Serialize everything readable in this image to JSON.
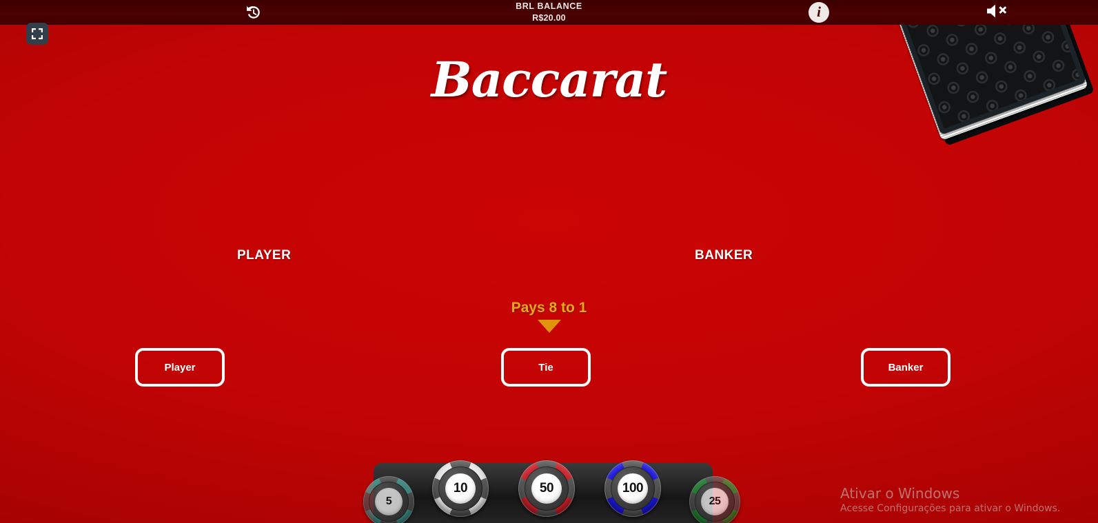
{
  "app": {
    "title": "Baccarat",
    "table_color": "#c20404",
    "accent_gold": "#e3a919"
  },
  "topbar": {
    "history_icon": "history-rewind-icon",
    "balance_label": "BRL BALANCE",
    "balance_value": "R$20.00",
    "info_icon": "info-icon",
    "info_glyph": "i"
  },
  "controls": {
    "fullscreen_icon": "fullscreen-expand-icon",
    "mute_icon": "speaker-muted-icon"
  },
  "table": {
    "deck_name": "card-deck",
    "spots": [
      {
        "key": "player",
        "header": "PLAYER",
        "button_label": "Player"
      },
      {
        "key": "tie",
        "header": "",
        "button_label": "Tie"
      },
      {
        "key": "banker",
        "header": "BANKER",
        "button_label": "Banker"
      }
    ],
    "player_header": "PLAYER",
    "banker_header": "BANKER",
    "player_label": "Player",
    "tie_label": "Tie",
    "banker_label": "Banker",
    "pays_note": "Pays 8 to 1"
  },
  "chips": {
    "selected": null,
    "items": [
      {
        "value": "5",
        "accent": "#3fa8a0",
        "partial": true,
        "side": "left"
      },
      {
        "value": "10",
        "accent": "#e9e9e9",
        "partial": false,
        "side": "center"
      },
      {
        "value": "50",
        "accent": "#cc1f28",
        "partial": false,
        "side": "center"
      },
      {
        "value": "100",
        "accent": "#1a16e0",
        "partial": false,
        "side": "center"
      },
      {
        "value": "25",
        "accent": "#1f9b33",
        "partial": true,
        "side": "right"
      }
    ]
  },
  "watermark": {
    "title": "Ativar o Windows",
    "subtitle": "Acesse Configurações para ativar o Windows."
  }
}
